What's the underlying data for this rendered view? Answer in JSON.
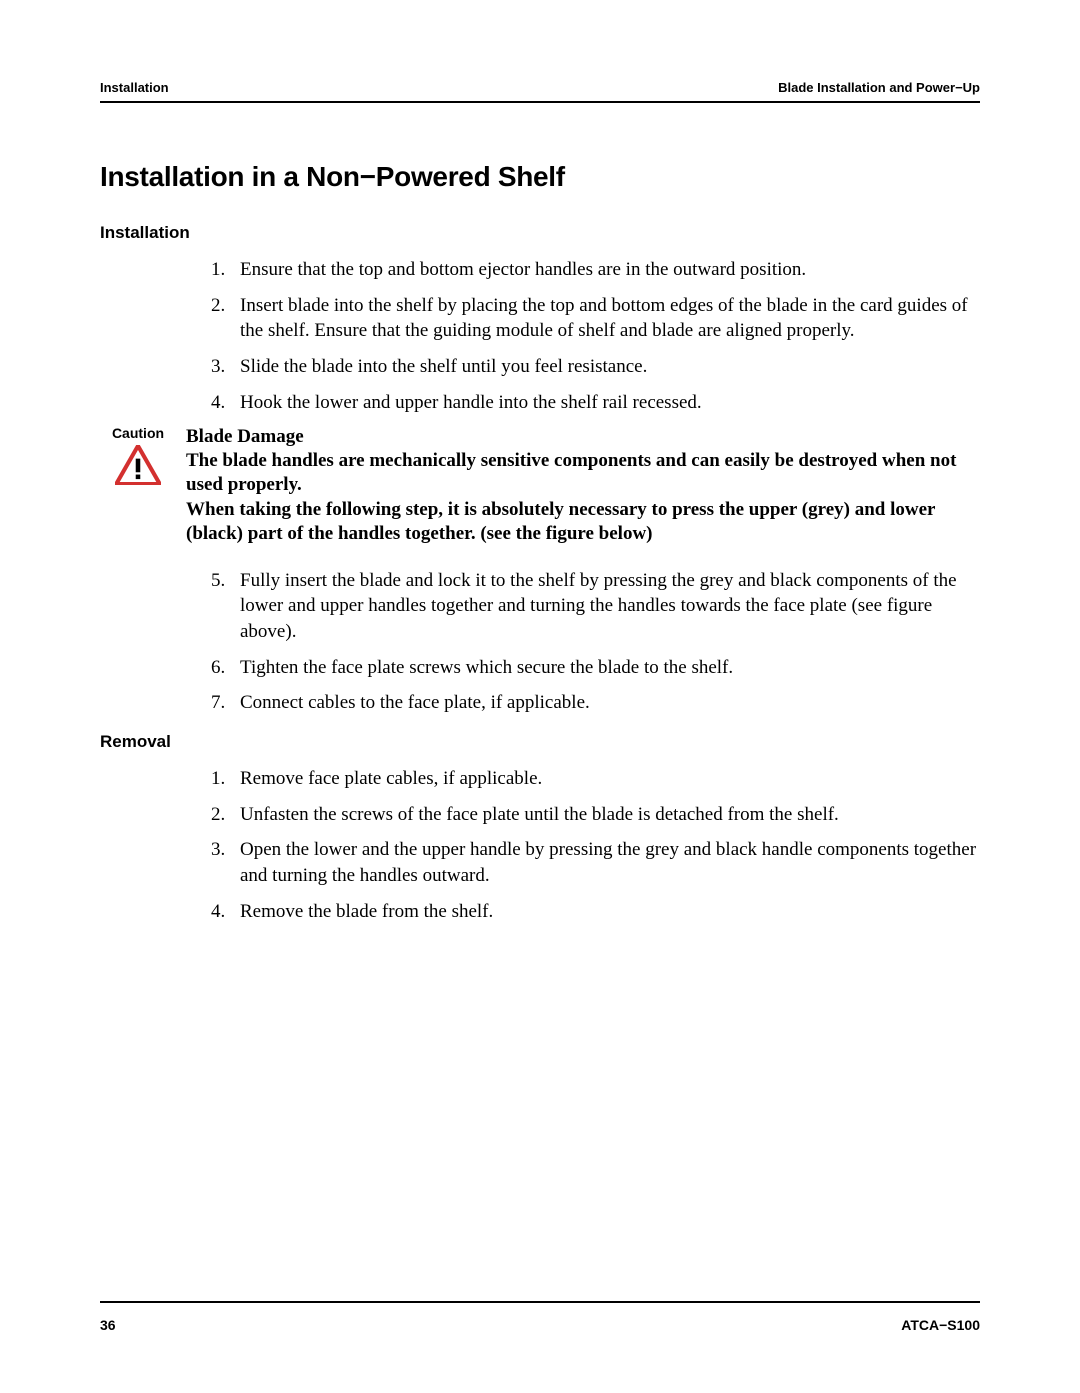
{
  "header": {
    "left": "Installation",
    "right": "Blade Installation and Power−Up"
  },
  "section_title": "Installation in a Non−Powered Shelf",
  "installation": {
    "heading": "Installation",
    "steps": [
      "Ensure that the top and bottom ejector handles are in the outward position.",
      "Insert blade into the shelf by placing the top and bottom edges of the blade in the card guides of the shelf. Ensure that the guiding module of shelf and blade are aligned properly.",
      "Slide the blade into the shelf until you feel resistance.",
      "Hook the lower and upper handle into the shelf rail recessed."
    ]
  },
  "caution": {
    "label": "Caution",
    "title": "Blade Damage",
    "para1": "The blade handles are mechanically sensitive components and can easily be destroyed when not used properly.",
    "para2": "When taking the following step, it is absolutely necessary to press the upper (grey) and lower (black) part of the handles together. (see the figure below)"
  },
  "installation_cont": {
    "steps": [
      "Fully insert the blade and lock it to the shelf by pressing the grey and black components of the lower and upper handles together and turning the handles towards the face plate (see figure above).",
      "Tighten the face plate screws which secure the blade to the shelf.",
      "Connect cables to the face plate, if applicable."
    ]
  },
  "removal": {
    "heading": "Removal",
    "steps": [
      "Remove face plate cables, if applicable.",
      "Unfasten the screws of the face plate until the blade is detached from the shelf.",
      "Open the lower and the upper handle by pressing the grey and black handle components together and turning the handles outward.",
      "Remove the blade from the shelf."
    ]
  },
  "footer": {
    "page": "36",
    "doc": "ATCA−S100"
  }
}
